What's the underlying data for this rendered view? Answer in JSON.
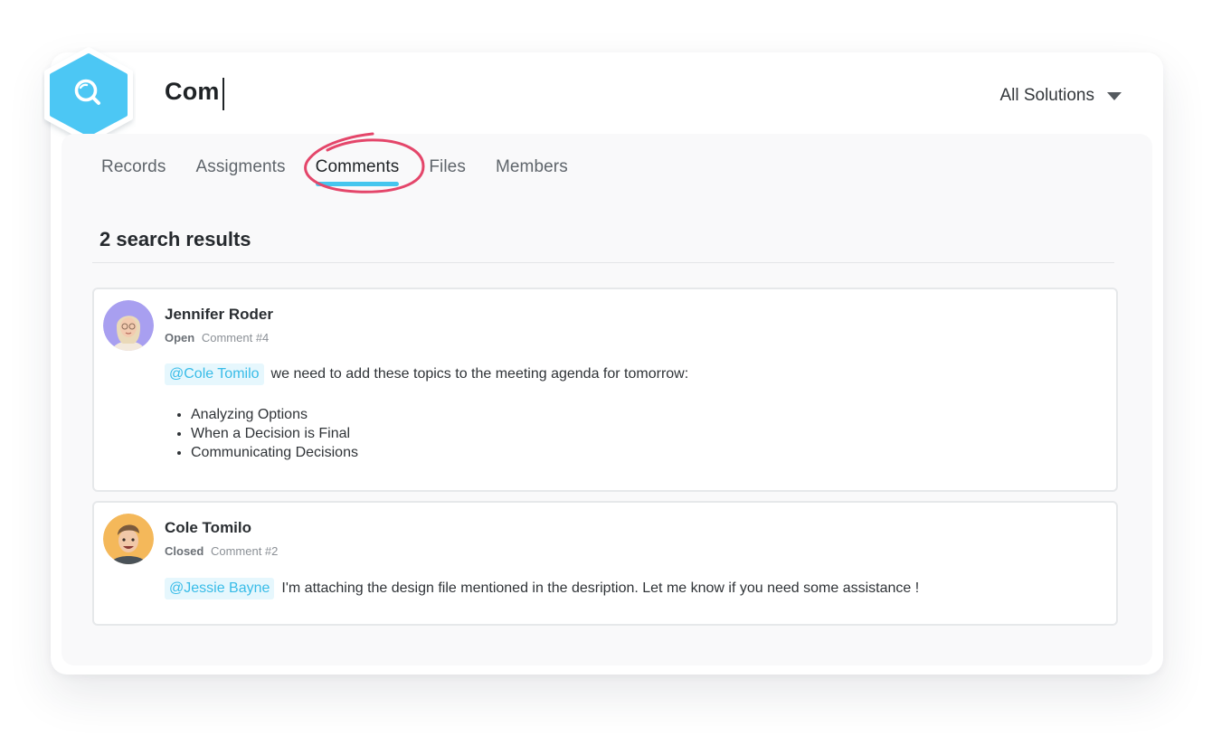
{
  "search": {
    "query": "Com",
    "scope_label": "All Solutions"
  },
  "tabs": [
    {
      "label": "Records",
      "active": false
    },
    {
      "label": "Assigments",
      "active": false
    },
    {
      "label": "Comments",
      "active": true
    },
    {
      "label": "Files",
      "active": false
    },
    {
      "label": "Members",
      "active": false
    }
  ],
  "results": {
    "title": "2 search results",
    "items": [
      {
        "author": "Jennifer Roder",
        "status": "Open",
        "ref": "Comment #4",
        "mention": "@Cole Tomilo",
        "text": "we need to add these topics to the meeting agenda for tomorrow:",
        "bullets": [
          "Analyzing Options",
          "When a Decision is Final",
          "Communicating Decisions"
        ]
      },
      {
        "author": "Cole Tomilo",
        "status": "Closed",
        "ref": "Comment #2",
        "mention": "@Jessie Bayne",
        "text": "I'm attaching the design file mentioned in the desription. Let me know if you need some assistance !"
      }
    ]
  },
  "colors": {
    "accent": "#45c6ee",
    "badge": "#4cc7f4",
    "annotation": "#e4466a",
    "mention_bg": "#e6f7fd",
    "mention_text": "#38bce8"
  },
  "icons": {
    "badge": "search-icon",
    "scope": "chevron-down-icon",
    "highlight": "circle-annotation"
  }
}
